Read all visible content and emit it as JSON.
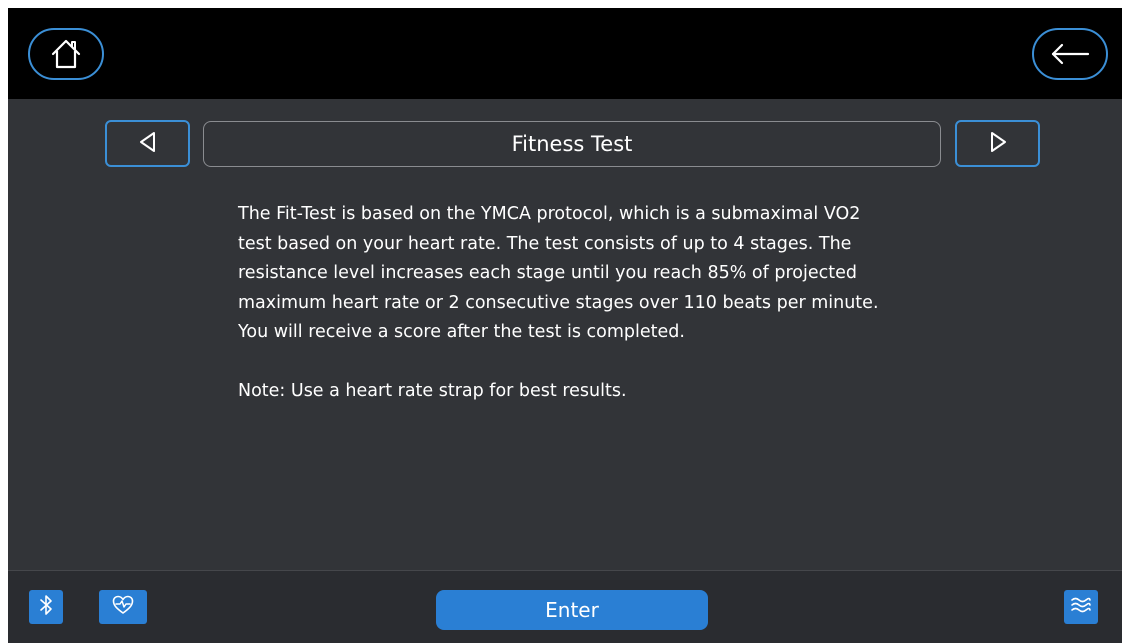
{
  "header": {
    "home_icon": "home-icon",
    "back_icon": "arrow-left-icon"
  },
  "navigation": {
    "title": "Fitness Test",
    "prev_icon": "triangle-left-icon",
    "next_icon": "triangle-right-icon"
  },
  "description": {
    "lines": [
      "The Fit-Test is based on the YMCA protocol, which is a submaximal VO2",
      "test based on your heart rate. The test consists of up to 4 stages. The",
      "resistance level increases each stage until you reach 85% of projected",
      "maximum heart rate or 2 consecutive stages over 110 beats per minute.",
      "You will receive a score after the test is completed."
    ],
    "note": "Note: Use a heart rate strap for best results."
  },
  "footer": {
    "enter_label": "Enter",
    "bluetooth_icon": "bluetooth-icon",
    "heart_rate_icon": "heart-rate-icon",
    "menu_icon": "waves-menu-icon"
  },
  "colors": {
    "accent": "#2a7fd4",
    "outline": "#3b8fd6",
    "background": "#323438",
    "topbar": "#000000"
  }
}
